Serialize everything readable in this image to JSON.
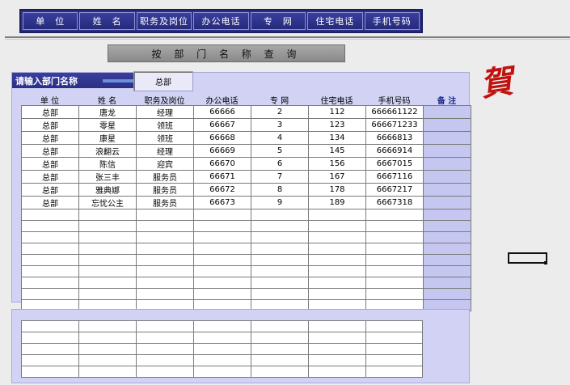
{
  "nav": [
    "单　位",
    "姓　名",
    "职务及岗位",
    "办公电话",
    "专　网",
    "住宅电话",
    "手机号码"
  ],
  "query_button": "按 部 门 名 称 查 询",
  "mark": "賀",
  "panel": {
    "label": "请输入部门名称",
    "dept_value": "总部"
  },
  "columns": [
    "单 位",
    "姓 名",
    "职务及岗位",
    "办公电话",
    "专 网",
    "住宅电话",
    "手机号码",
    "备 注"
  ],
  "rows": [
    [
      "总部",
      "唐龙",
      "经理",
      "66666",
      "2",
      "112",
      "666661122",
      ""
    ],
    [
      "总部",
      "零星",
      "领班",
      "66667",
      "3",
      "123",
      "666671233",
      ""
    ],
    [
      "总部",
      "康星",
      "领班",
      "66668",
      "4",
      "134",
      "6666813",
      ""
    ],
    [
      "总部",
      "浪翻云",
      "经理",
      "66669",
      "5",
      "145",
      "6666914",
      ""
    ],
    [
      "总部",
      "陈信",
      "迎宾",
      "66670",
      "6",
      "156",
      "6667015",
      ""
    ],
    [
      "总部",
      "张三丰",
      "服务员",
      "66671",
      "7",
      "167",
      "6667116",
      ""
    ],
    [
      "总部",
      "雅典娜",
      "服务员",
      "66672",
      "8",
      "178",
      "6667217",
      ""
    ],
    [
      "总部",
      "忘忧公主",
      "服务员",
      "66673",
      "9",
      "189",
      "6667318",
      ""
    ]
  ],
  "empty_rows": 9,
  "lower_empty_rows": 5
}
